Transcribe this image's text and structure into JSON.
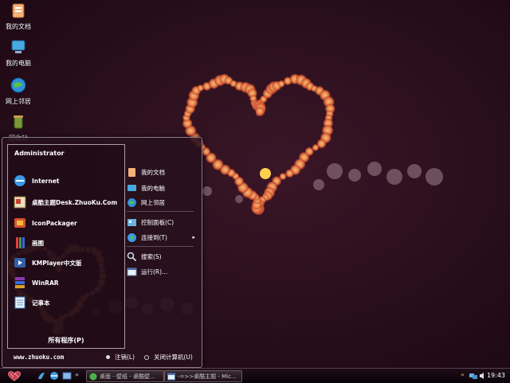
{
  "desktop": {
    "icons": [
      {
        "label": "我的文档",
        "icon": "my-documents-icon"
      },
      {
        "label": "我的电脑",
        "icon": "my-computer-icon"
      },
      {
        "label": "网上邻居",
        "icon": "network-places-icon"
      },
      {
        "label": "回收站",
        "icon": "recycle-bin-icon"
      }
    ]
  },
  "start_menu": {
    "user_name": "Administrator",
    "programs": [
      {
        "label": "Internet",
        "icon": "internet-explorer-icon"
      },
      {
        "label": "桌酷主题Desk.ZhuoKu.Com",
        "icon": "zhuoku-theme-icon"
      },
      {
        "label": "IconPackager",
        "icon": "iconpackager-icon"
      },
      {
        "label": "画图",
        "icon": "paint-icon"
      },
      {
        "label": "KMPlayer中文版",
        "icon": "kmplayer-icon"
      },
      {
        "label": "WinRAR",
        "icon": "winrar-icon"
      },
      {
        "label": "记事本",
        "icon": "notepad-icon"
      }
    ],
    "all_programs": "所有程序(P)",
    "places": [
      {
        "label": "我的文档",
        "icon": "my-documents-icon"
      },
      {
        "label": "我的电脑",
        "icon": "my-computer-icon"
      },
      {
        "label": "网上邻居",
        "icon": "network-places-icon"
      },
      {
        "label": "控制面板(C)",
        "icon": "control-panel-icon"
      },
      {
        "label": "连接到(T)",
        "icon": "connect-to-icon",
        "arrow": "▸"
      },
      {
        "label": "搜索(S)",
        "icon": "search-icon"
      },
      {
        "label": "运行(R)...",
        "icon": "run-icon"
      }
    ],
    "website": "www.zhuoku.com",
    "logoff": "注销(L)",
    "shutdown": "关闭计算机(U)"
  },
  "taskbar": {
    "tasks": [
      {
        "label": "桌面 - 壁纸 - 桌酷壁...",
        "icon": "browser-icon"
      },
      {
        "label": "-=>>桌酷主题 - Mic...",
        "icon": "window-icon"
      }
    ],
    "clock": "19:43",
    "overflow_glyph": "»",
    "tray_glyph": "«"
  }
}
